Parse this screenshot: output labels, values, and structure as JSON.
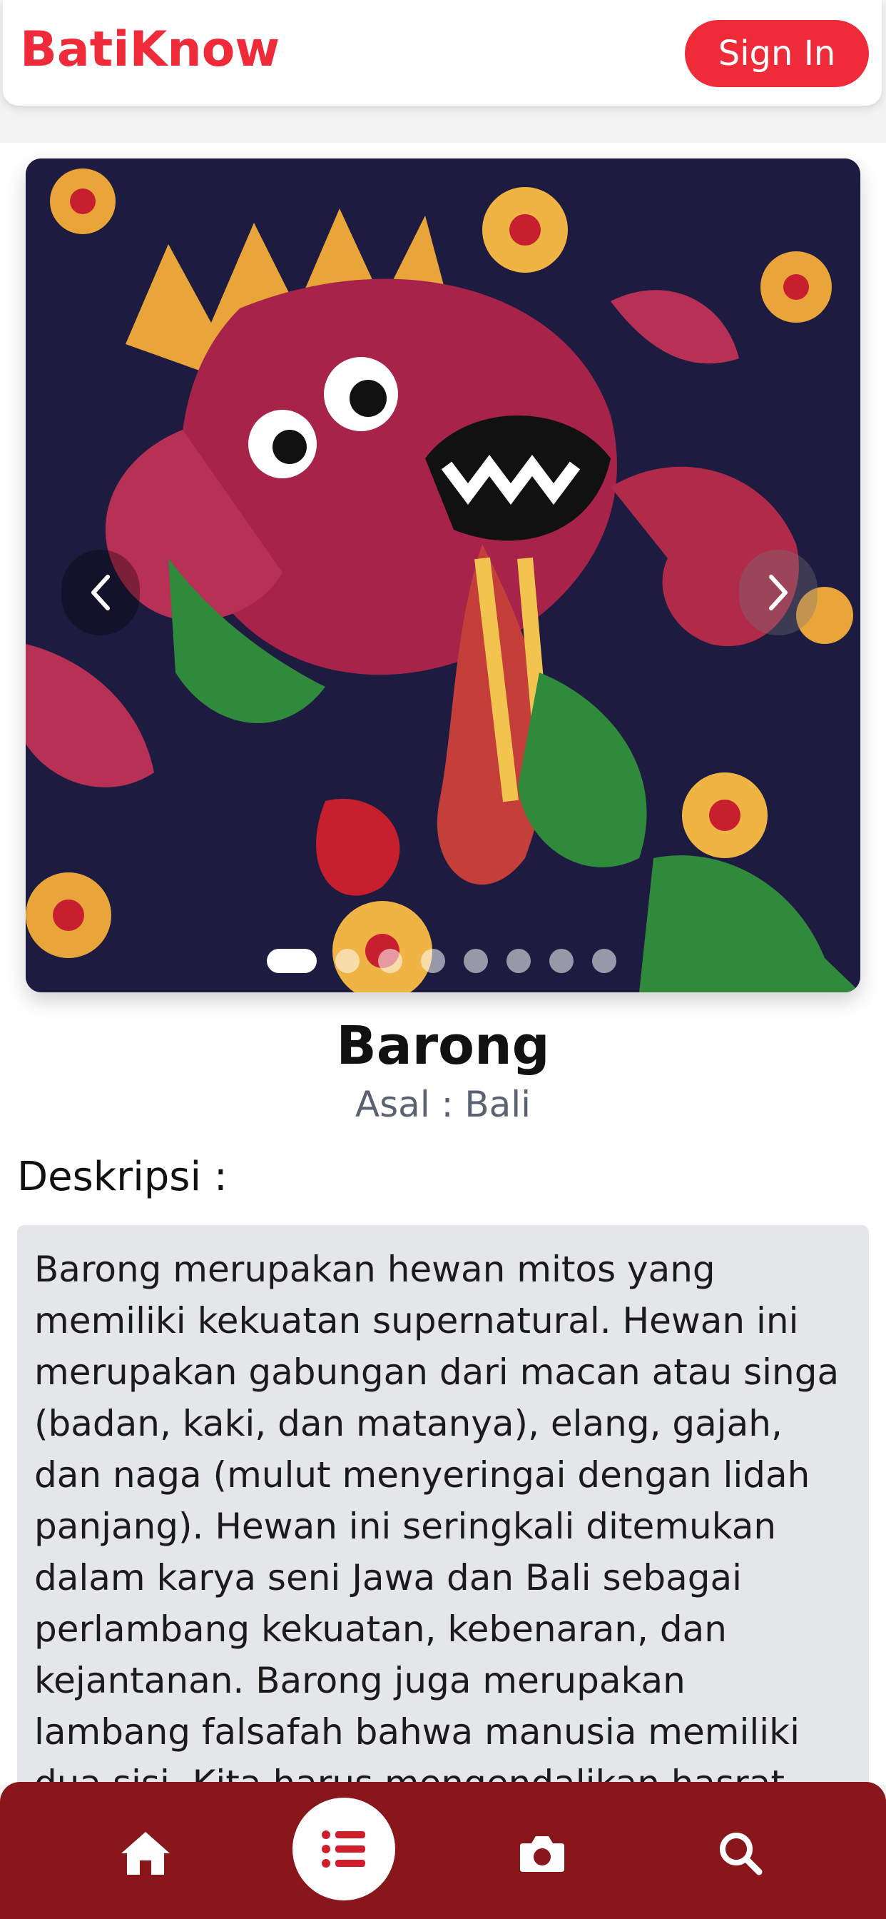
{
  "header": {
    "brand": "BatiKnow",
    "signin_label": "Sign In"
  },
  "carousel": {
    "slide_count": 8,
    "active_index": 0,
    "prev_icon": "chevron-left-icon",
    "next_icon": "chevron-right-icon"
  },
  "detail": {
    "title": "Barong",
    "origin": "Asal : Bali",
    "description_label": "Deskripsi :",
    "description": "Barong merupakan hewan mitos yang memiliki kekuatan supernatural. Hewan ini merupakan gabungan dari macan atau singa (badan, kaki, dan matanya), elang, gajah, dan naga (mulut menyeringai dengan lidah panjang). Hewan ini seringkali ditemukan dalam karya seni Jawa dan Bali sebagai perlambang kekuatan, kebenaran, dan kejantanan. Barong juga merupakan lambang falsafah bahwa manusia memiliki dua sisi. Kita harus mengendalikan hasrat buruk dan"
  },
  "bottom_nav": {
    "items": [
      {
        "icon": "home-icon"
      },
      {
        "icon": "list-icon",
        "active": true
      },
      {
        "icon": "camera-icon"
      },
      {
        "icon": "search-icon"
      }
    ]
  },
  "colors": {
    "brand": "#ef2b39",
    "nav_bg": "#88161b",
    "desc_bg": "#e5e6ea"
  }
}
